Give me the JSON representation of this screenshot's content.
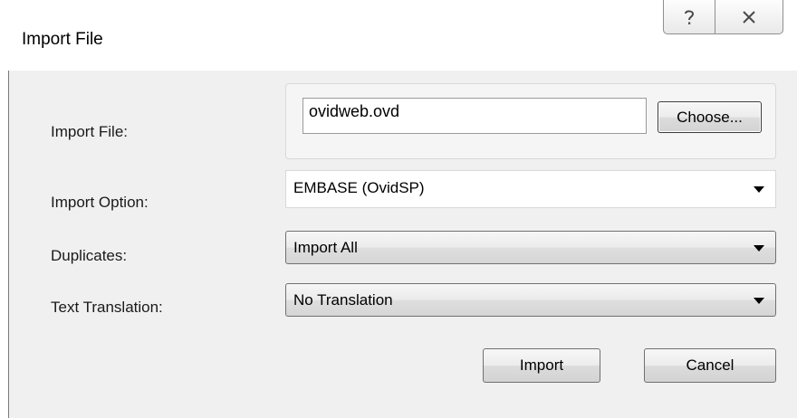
{
  "window": {
    "title": "Import File",
    "help_icon": "question-mark-icon",
    "close_icon": "close-x-icon"
  },
  "form": {
    "import_file": {
      "label": "Import File:",
      "value": "ovidweb.ovd",
      "choose_label": "Choose..."
    },
    "import_option": {
      "label": "Import Option:",
      "selected": "EMBASE (OvidSP)"
    },
    "duplicates": {
      "label": "Duplicates:",
      "selected": "Import All"
    },
    "text_translation": {
      "label": "Text Translation:",
      "selected": "No Translation"
    }
  },
  "actions": {
    "import_label": "Import",
    "cancel_label": "Cancel"
  },
  "colors": {
    "dialog_background": "#f0f0f0",
    "titlebar_background": "#ffffff",
    "button_border": "#707070"
  }
}
